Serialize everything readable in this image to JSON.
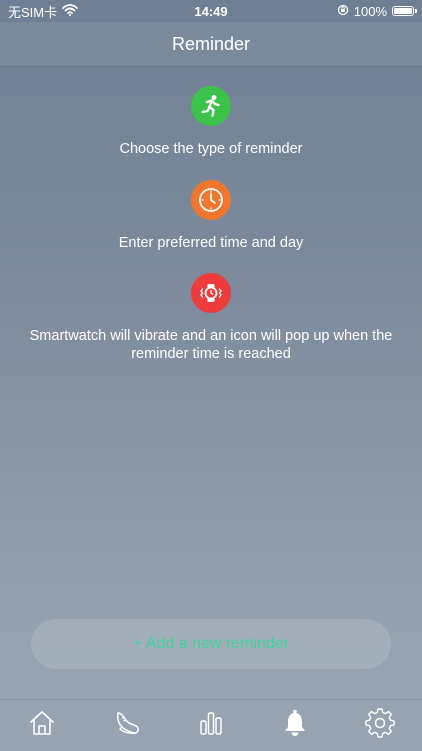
{
  "status_bar": {
    "carrier": "无SIM卡",
    "time": "14:49",
    "battery_percent": "100%",
    "battery_level": 1.0,
    "icons": [
      "wifi-icon",
      "orientation-lock-icon",
      "battery-icon"
    ]
  },
  "header": {
    "title": "Reminder"
  },
  "steps": [
    {
      "icon": "running-person-icon",
      "color": "#3cc24b",
      "text": "Choose the type of reminder"
    },
    {
      "icon": "clock-icon",
      "color": "#f0762e",
      "text": "Enter preferred time and day"
    },
    {
      "icon": "vibrating-watch-icon",
      "color": "#ee3b3b",
      "text": "Smartwatch will vibrate and an icon will pop up when the reminder time is reached"
    }
  ],
  "add_button": {
    "label": "+ Add a new reminder",
    "color": "#3fd39d"
  },
  "tab_bar": {
    "tabs": [
      {
        "name": "home",
        "icon": "home-icon"
      },
      {
        "name": "activity",
        "icon": "shoe-icon"
      },
      {
        "name": "stats",
        "icon": "bar-chart-icon"
      },
      {
        "name": "reminder",
        "icon": "bell-icon",
        "active": true
      },
      {
        "name": "settings",
        "icon": "gear-icon"
      }
    ]
  }
}
